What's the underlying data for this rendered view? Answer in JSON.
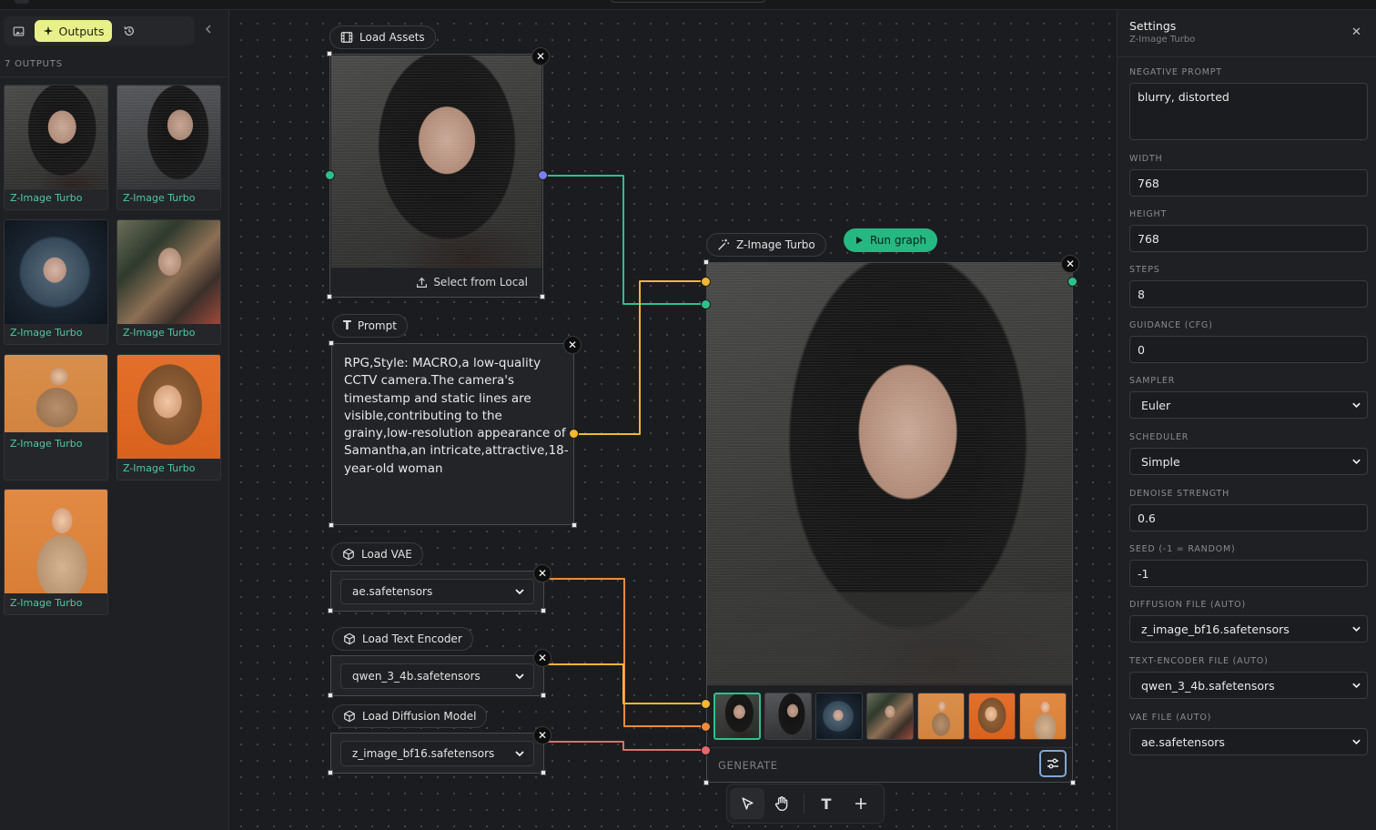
{
  "sidebar": {
    "outputs_label": "Outputs",
    "outputs_count": "7 OUTPUTS",
    "items": [
      {
        "label": "Z-Image Turbo"
      },
      {
        "label": "Z-Image Turbo"
      },
      {
        "label": "Z-Image Turbo"
      },
      {
        "label": "Z-Image Turbo"
      },
      {
        "label": "Z-Image Turbo"
      },
      {
        "label": "Z-Image Turbo"
      },
      {
        "label": "Z-Image Turbo"
      }
    ]
  },
  "nodes": {
    "load_assets": {
      "title": "Load Assets",
      "select_local": "Select from Local"
    },
    "prompt": {
      "title": "Prompt",
      "text": "RPG,Style: MACRO,a low-quality CCTV camera.The camera's timestamp and static lines are visible,contributing to the grainy,low-resolution appearance of Samantha,an intricate,attractive,18-year-old woman"
    },
    "load_vae": {
      "title": "Load VAE",
      "value": "ae.safetensors"
    },
    "load_text_encoder": {
      "title": "Load Text Encoder",
      "value": "qwen_3_4b.safetensors"
    },
    "load_diffusion_model": {
      "title": "Load Diffusion Model",
      "value": "z_image_bf16.safetensors"
    },
    "z_image_turbo": {
      "title": "Z-Image Turbo",
      "run_label": "Run graph",
      "generate_placeholder": "GENERATE"
    }
  },
  "settings": {
    "title": "Settings",
    "subtitle": "Z-Image Turbo",
    "negative_prompt_label": "NEGATIVE PROMPT",
    "negative_prompt": "blurry, distorted",
    "width_label": "WIDTH",
    "width": "768",
    "height_label": "HEIGHT",
    "height": "768",
    "steps_label": "STEPS",
    "steps": "8",
    "guidance_label": "GUIDANCE (CFG)",
    "guidance": "0",
    "sampler_label": "SAMPLER",
    "sampler": "Euler",
    "scheduler_label": "SCHEDULER",
    "scheduler": "Simple",
    "denoise_label": "DENOISE STRENGTH",
    "denoise": "0.6",
    "seed_label": "SEED (-1 = RANDOM)",
    "seed": "-1",
    "diffusion_file_label": "DIFFUSION FILE (AUTO)",
    "diffusion_file": "z_image_bf16.safetensors",
    "text_encoder_file_label": "TEXT-ENCODER FILE (AUTO)",
    "text_encoder_file": "qwen_3_4b.safetensors",
    "vae_file_label": "VAE FILE (AUTO)",
    "vae_file": "ae.safetensors"
  },
  "colors": {
    "accent_yellow": "#e8f08a",
    "run_green": "#25b882",
    "wire_green": "#2ec08a",
    "wire_yellow": "#f5b731",
    "wire_orange": "#f08a3a",
    "wire_red": "#e46a6a",
    "port_blue": "#7c7ef0"
  },
  "icons": [
    "image-icon",
    "sparkle-icon",
    "history-icon",
    "chevron-left-icon",
    "film-icon",
    "upload-icon",
    "text-icon",
    "cube-icon",
    "wand-icon",
    "play-icon",
    "sliders-icon",
    "pointer-icon",
    "hand-icon",
    "plus-icon",
    "close-icon",
    "chevron-down-icon"
  ]
}
